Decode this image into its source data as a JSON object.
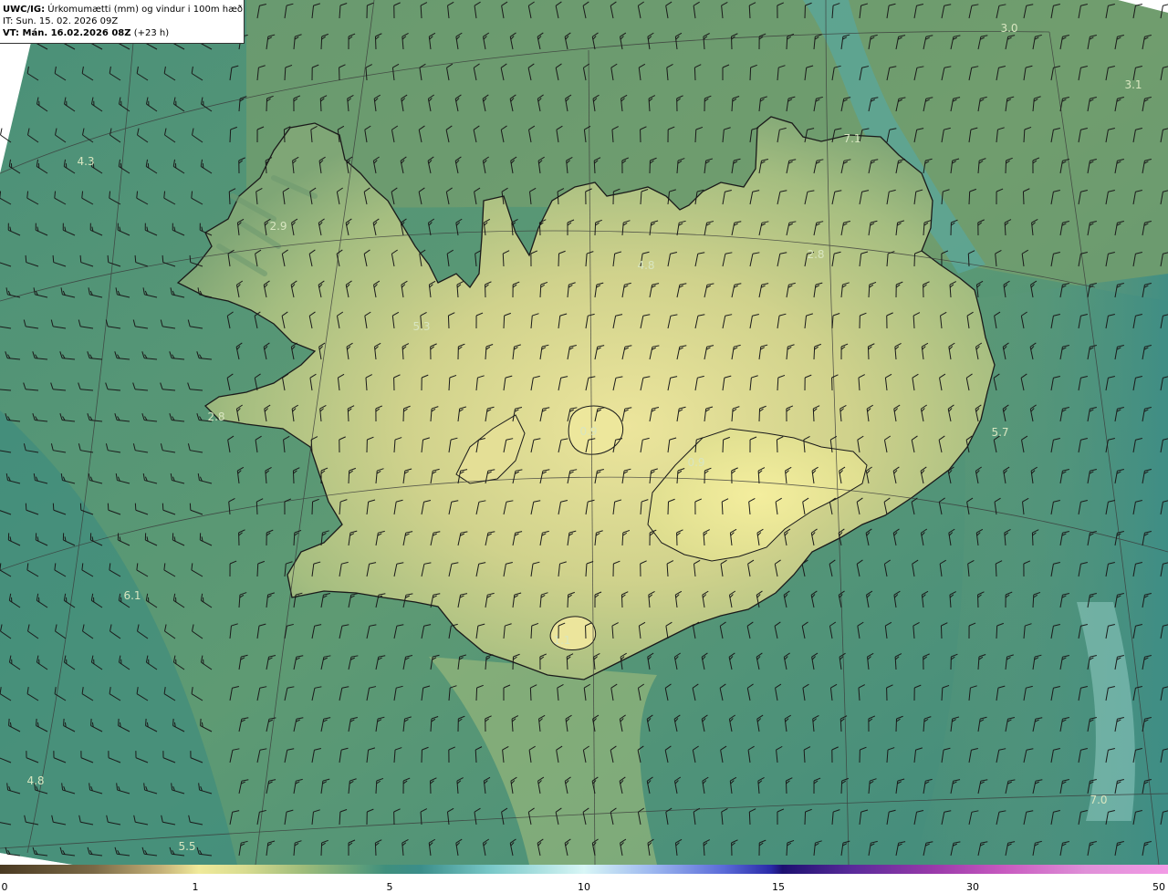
{
  "header": {
    "product": "UWC/IG:",
    "description": "Úrkomumætti (mm) og vindur i 100m hæð",
    "init_time": "IT: Sun. 15. 02. 2026 09Z",
    "valid_label": "VT: Mán. 16.02.2026 08Z",
    "lead": "(+23 h)"
  },
  "value_labels": [
    "3.0",
    "3.1",
    "4.3",
    "2.9",
    "7.1",
    "2.8",
    "4.8",
    "5.3",
    "2.8",
    "0.9",
    "0.9",
    "5.7",
    "6.1",
    "1.1",
    "4.8",
    "5.5",
    "7.0"
  ],
  "colorbar": {
    "ticks": [
      "0",
      "1",
      "5",
      "10",
      "15",
      "30",
      "50"
    ],
    "unit": "mm"
  },
  "colors": {
    "ocean_teal": "#3f8a78",
    "land_yellow": "#e6e295",
    "land_green": "#8fb079",
    "coastline": "#1a1a1a"
  },
  "icons": [
    "wind-barb-icon",
    "calm-circle-icon"
  ]
}
